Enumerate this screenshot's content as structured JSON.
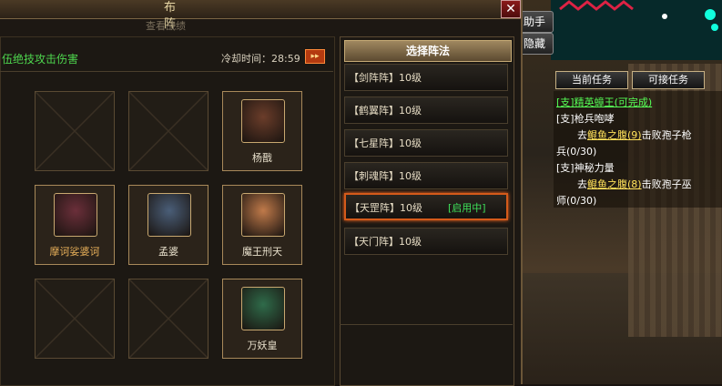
{
  "window": {
    "title": "布 阵",
    "subtitle": "查看战绩",
    "close_label": "✕"
  },
  "skill_text": "伍绝技攻击伤害",
  "cooldown": {
    "label": "冷却时间：28:59",
    "button_label": "▸▸"
  },
  "grid": [
    {
      "name": "",
      "filled": false
    },
    {
      "name": "",
      "filled": false
    },
    {
      "name": "杨戬",
      "filled": true,
      "color": "#e8e0cc"
    },
    {
      "name": "摩诃娑婆诃",
      "filled": true,
      "color": "#e8b05a"
    },
    {
      "name": "孟婆",
      "filled": true,
      "color": "#e8e0cc"
    },
    {
      "name": "魔王刑天",
      "filled": true,
      "color": "#e8e0cc"
    },
    {
      "name": "",
      "filled": false
    },
    {
      "name": "",
      "filled": false
    },
    {
      "name": "万妖皇",
      "filled": true,
      "color": "#e8e0cc"
    }
  ],
  "formation_panel": {
    "header": "选择阵法",
    "items": [
      {
        "label": "【剑阵阵】10级",
        "status": ""
      },
      {
        "label": "【鹤翼阵】10级",
        "status": ""
      },
      {
        "label": "【七星阵】10级",
        "status": ""
      },
      {
        "label": "【刺魂阵】10级",
        "status": ""
      },
      {
        "label": "【天罡阵】10级",
        "status": "[启用中]"
      },
      {
        "label": "【天门阵】10级",
        "status": ""
      }
    ],
    "active_index": 4
  },
  "side_buttons": {
    "top": "助手",
    "bottom": "隐藏"
  },
  "tasks": {
    "tab_current": "当前任务",
    "tab_available": "可接任务",
    "lines": [
      {
        "text": "[支]精英蟑王(可完成)",
        "style": "green"
      },
      {
        "text": "[支]枪兵咆哮",
        "style": "white"
      },
      {
        "prefix": "去",
        "link": "鲲鱼之腹(9)",
        "suffix": "击败孢子枪",
        "style": "white"
      },
      {
        "text": "兵(0/30)",
        "style": "white"
      },
      {
        "text": "[支]神秘力量",
        "style": "white"
      },
      {
        "prefix": "去",
        "link": "鲲鱼之腹(8)",
        "suffix": "击败孢子巫",
        "style": "white"
      },
      {
        "text": "师(0/30)",
        "style": "white"
      }
    ]
  },
  "colors": {
    "accent_active": "#d45a1a",
    "status_green": "#3ee05a",
    "skill_green": "#4ed64e"
  }
}
